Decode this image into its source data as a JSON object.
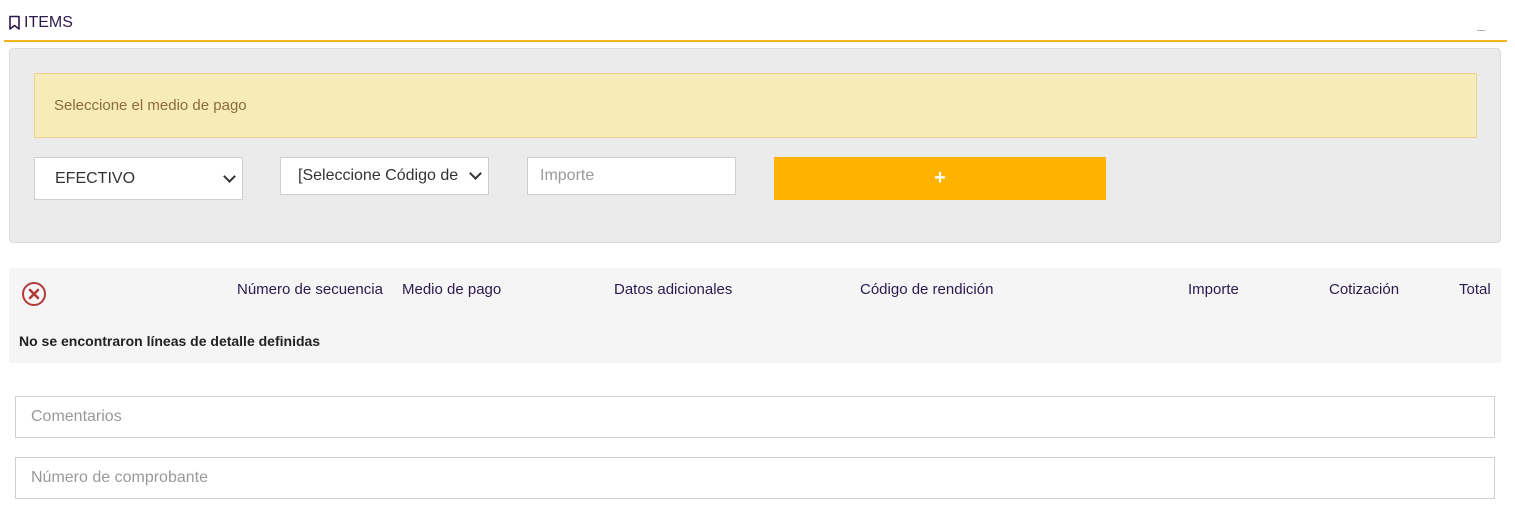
{
  "section": {
    "title": "ITEMS",
    "minimize_label": "_",
    "icon": "bookmark-icon"
  },
  "panel": {
    "alert_text": "Seleccione el medio de pago",
    "medio_pago_select": {
      "selected": "EFECTIVO"
    },
    "codigo_select": {
      "selected": "[Seleccione Código de"
    },
    "importe_input": {
      "placeholder": "Importe",
      "value": ""
    },
    "add_button": {
      "label": "+",
      "color": "#ffb300"
    }
  },
  "table": {
    "clear_icon": "x-circle-icon",
    "columns": [
      "Número de secuencia",
      "Medio de pago",
      "Datos adicionales",
      "Código de rendición",
      "Importe",
      "Cotización",
      "Total"
    ],
    "empty_message": "No se encontraron líneas de detalle definidas"
  },
  "form": {
    "comentarios": {
      "placeholder": "Comentarios",
      "value": ""
    },
    "comprobante": {
      "placeholder": "Número de comprobante",
      "value": ""
    }
  },
  "colors": {
    "accent": "#f2b41c",
    "button": "#ffb300",
    "alert_bg": "#f7ebb9",
    "title": "#2c1a4d",
    "clear_icon": "#b03a3a"
  }
}
